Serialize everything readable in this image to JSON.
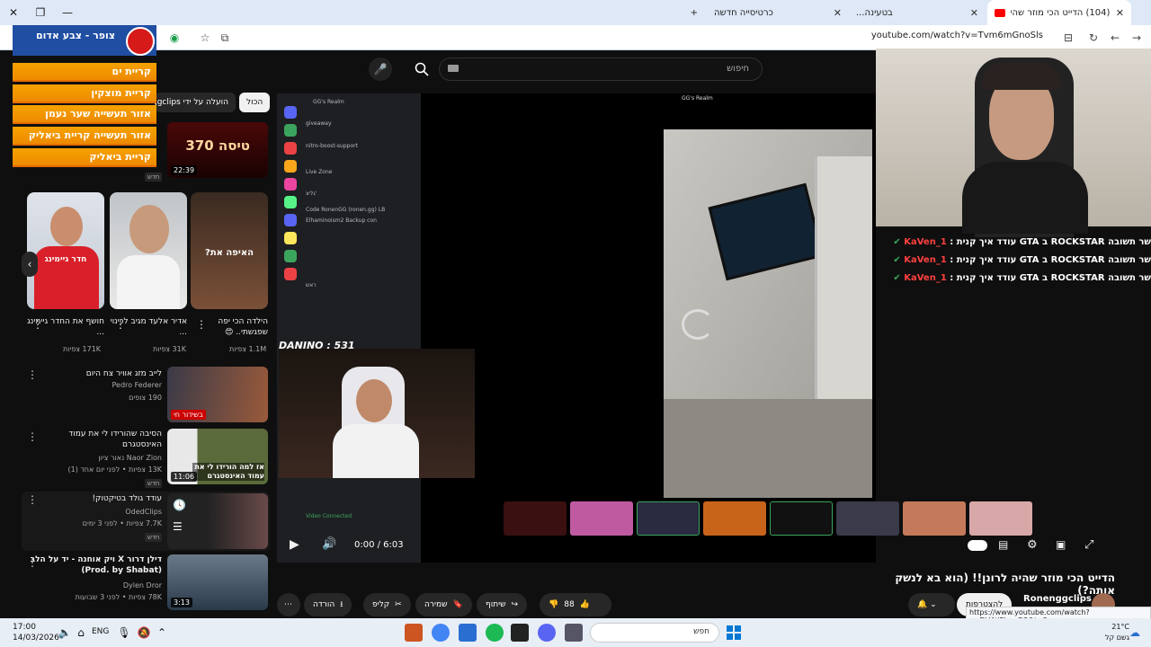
{
  "browser": {
    "tabs": [
      {
        "title": "(104) הדייט הכי מוזר שהיה לרונ...",
        "active": true
      },
      {
        "title": "בטעינה...",
        "active": false
      },
      {
        "title": "כרטיסייה חדשה",
        "active": false
      }
    ],
    "new_tab_label": "+",
    "url": "youtube.com/watch?v=Tvm6mGnoSls"
  },
  "alert_widget": {
    "title": "צופר - צבע אדום",
    "locations": [
      "קריית ים",
      "קריית מוצקין",
      "אזור תעשייה שער נעמן",
      "אזור תעשייה קריית ביאליק",
      "קריית ביאליק"
    ]
  },
  "youtube": {
    "search_placeholder": "חיפוש",
    "chips": {
      "all": "הכול",
      "uploaded_by": "הועלה על ידי Ronenggclips"
    },
    "sidebar_videos": [
      {
        "title": "",
        "meta": "",
        "duration": "22:39",
        "badge": "חדש",
        "thumb_text": "טיסה 370"
      },
      {
        "title": "לייב מזג אוויר צח היום",
        "channel": "Pedro Federer",
        "meta": "190 צופים",
        "duration": "",
        "live": "בשידור חי"
      },
      {
        "title": "הסיבה שהורידו לי את עמוד האינסטגרם",
        "channel": "Naor Zion נאור ציון",
        "meta": "13K צפיות • לפני יום אחד (1)",
        "duration": "11:06",
        "badge": "חדש",
        "thumb_text": "אז למה הורידו לי את עמוד האינסטגרם"
      },
      {
        "title": "עודד גולד בטיקטוק!",
        "channel": "OdedClips",
        "meta": "7.7K צפיות • לפני 3 ימים",
        "duration": "",
        "badge": "חדש"
      },
      {
        "title": "דילן דרור X ויק אוחנה - יד על הלב (Prod. by Shabat)",
        "channel": "Dylen Dror",
        "meta": "78K צפיות • לפני 3 שבועות",
        "duration": "3:13"
      }
    ],
    "shorts": [
      {
        "title": "הילדה הכי יפה שפגשתי.. 😍",
        "views": "1.1M צפיות",
        "thumb_text": "האיפה את?"
      },
      {
        "title": "אדיר אלעד מגיב לכינוי ...",
        "views": "31K צפיות"
      },
      {
        "title": "חושף את החדר גיימינג ...",
        "views": "171K צפיות",
        "thumb_text": "חדר גיימינג"
      }
    ],
    "player": {
      "time": "0:00 / 6:03",
      "overlay_name": "DANINO : 531",
      "discord_server": "GG's Realm",
      "discord_channels": [
        "giveaway",
        "nitro-boost-support",
        "Live Zone",
        "גליצ'",
        "Code RonenGG (ronen.gg) LB",
        "Elhaminoism2 Backup con",
        "ראש"
      ],
      "video_connected": "Video Connected"
    },
    "chat": [
      {
        "user": "KaVen_1",
        "text": "שר תשובה ROCKSTAR ב GTA עודד איך קנית :"
      },
      {
        "user": "KaVen_1",
        "text": "שר תשובה ROCKSTAR ב GTA עודד איך קנית :"
      },
      {
        "user": "KaVen_1",
        "text": "שר תשובה ROCKSTAR ב GTA עודד איך קנית :"
      }
    ],
    "video_title": "הדייט הכי מוזר שהיה לרונן!! (הוא בא לנשק אותה?)",
    "channel_name": "Ronenggclips",
    "subscribe_label": "להצטרפות",
    "actions": {
      "likes": "88",
      "share": "שיתוף",
      "save": "שמירה",
      "clip": "קליפ",
      "download": "הורדה"
    }
  },
  "status_tooltip": "https://www.youtube.com/watch?v=DV4tIPbeoGQ&t=3s",
  "taskbar": {
    "time": "17:00",
    "date": "14/03/2026",
    "lang": "ENG",
    "search_placeholder": "חפש",
    "weather_temp": "21°C",
    "weather_desc": "גשם קל"
  },
  "colors": {
    "alert_orange": "#f29a00",
    "chat_user_red": "#ff4040",
    "yt_bg": "#0f0f0f"
  }
}
